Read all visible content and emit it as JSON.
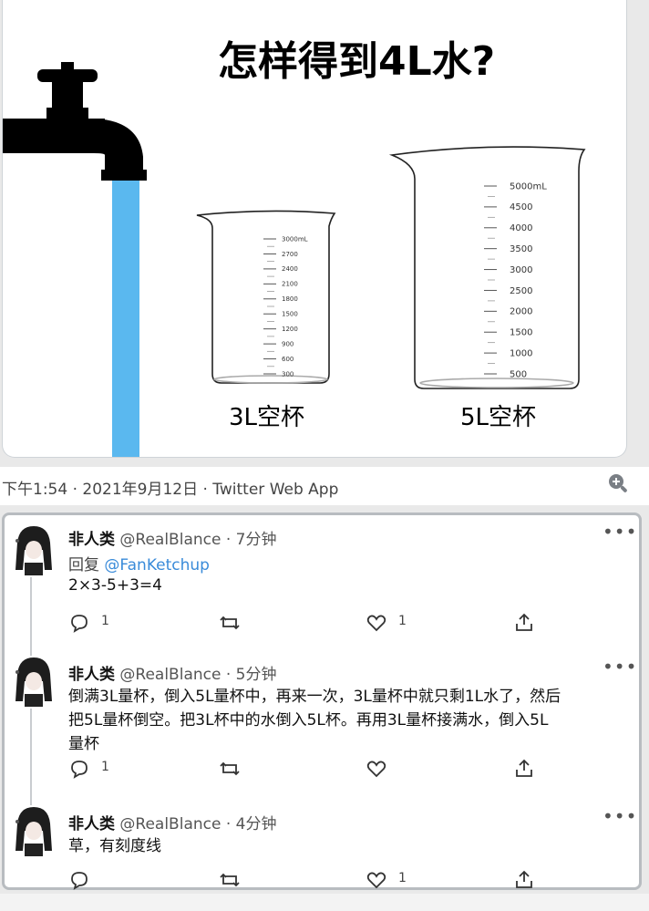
{
  "image": {
    "title": "怎样得到4L水?",
    "cup_small_label": "3L空杯",
    "cup_large_label": "5L空杯",
    "small_ticks": [
      "3000mL",
      "2700",
      "2400",
      "2100",
      "1800",
      "1500",
      "1200",
      "900",
      "600",
      "300"
    ],
    "large_ticks": [
      "5000mL",
      "4500",
      "4000",
      "3500",
      "3000",
      "2500",
      "2000",
      "1500",
      "1000",
      "500"
    ],
    "water_color": "#5ab8ef"
  },
  "meta": {
    "text": "下午1:54 · 2021年9月12日 · Twitter Web App",
    "zoom_icon": "zoom-in-icon"
  },
  "replies": [
    {
      "name": "非人类",
      "handle": "@RealBlance · 7分钟",
      "replying_prefix": "回复",
      "replying_to": "@FanKetchup",
      "text": "2×3-5+3=4",
      "reply_count": "1",
      "retweet_count": "",
      "like_count": "1"
    },
    {
      "name": "非人类",
      "handle": "@RealBlance · 5分钟",
      "line1": "倒满3L量杯，倒入5L量杯中，再来一次，3L量杯中就只剩1L水了，然后",
      "line2": "把5L量杯倒空。把3L杯中的水倒入5L杯。再用3L量杯接满水，倒入5L",
      "line3": "量杯",
      "reply_count": "1",
      "retweet_count": "",
      "like_count": ""
    },
    {
      "name": "非人类",
      "handle": "@RealBlance · 4分钟",
      "text": "草，有刻度线",
      "reply_count": "",
      "retweet_count": "",
      "like_count": "1"
    }
  ],
  "icons": {
    "more": "•••",
    "reply": "reply-icon",
    "retweet": "retweet-icon",
    "like": "heart-icon",
    "share": "share-icon"
  }
}
